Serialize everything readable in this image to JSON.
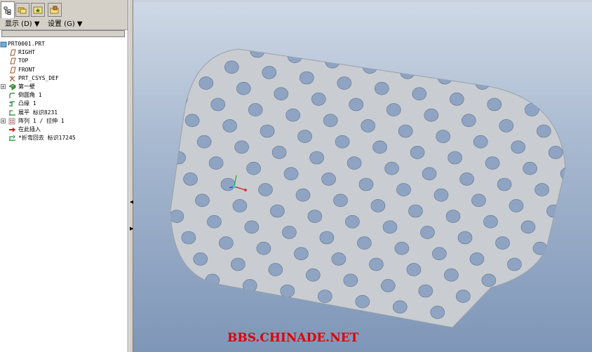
{
  "menubar": {
    "display_label": "显示 (D) ▼",
    "settings_label": "设置 (G) ▼"
  },
  "tree": {
    "items": [
      {
        "label": "PRT0001.PRT",
        "icon": "part-icon",
        "expandable": false
      },
      {
        "label": "RIGHT",
        "icon": "datum-plane-icon",
        "expandable": false
      },
      {
        "label": "TOP",
        "icon": "datum-plane-icon",
        "expandable": false
      },
      {
        "label": "FRONT",
        "icon": "datum-plane-icon",
        "expandable": false
      },
      {
        "label": "PRT_CSYS_DEF",
        "icon": "csys-icon",
        "expandable": false
      },
      {
        "label": "第一壁",
        "icon": "sheetmetal-wall-icon",
        "expandable": true
      },
      {
        "label": "倒圆角 1",
        "icon": "round-icon",
        "expandable": false
      },
      {
        "label": "凸缘 1",
        "icon": "flange-icon",
        "expandable": false
      },
      {
        "label": "展平 标识8231",
        "icon": "unbend-icon",
        "expandable": false
      },
      {
        "label": "阵列 1 / 拉伸 1",
        "icon": "pattern-icon",
        "expandable": true
      },
      {
        "label": "在此插入",
        "icon": "insert-here-arrow-icon",
        "expandable": false
      },
      {
        "label": "*折弯回去 标识17245",
        "icon": "bend-back-icon",
        "expandable": false
      }
    ]
  },
  "viewport": {
    "background_top": "#cfd9e6",
    "background_bottom": "#7e96b8",
    "part_color": "#c9cdd2"
  },
  "watermark": "BBS.CHINADE.NET",
  "colors": {
    "watermark": "#e00000",
    "tree_bg": "#ffffff",
    "chrome": "#d4d0c8"
  }
}
